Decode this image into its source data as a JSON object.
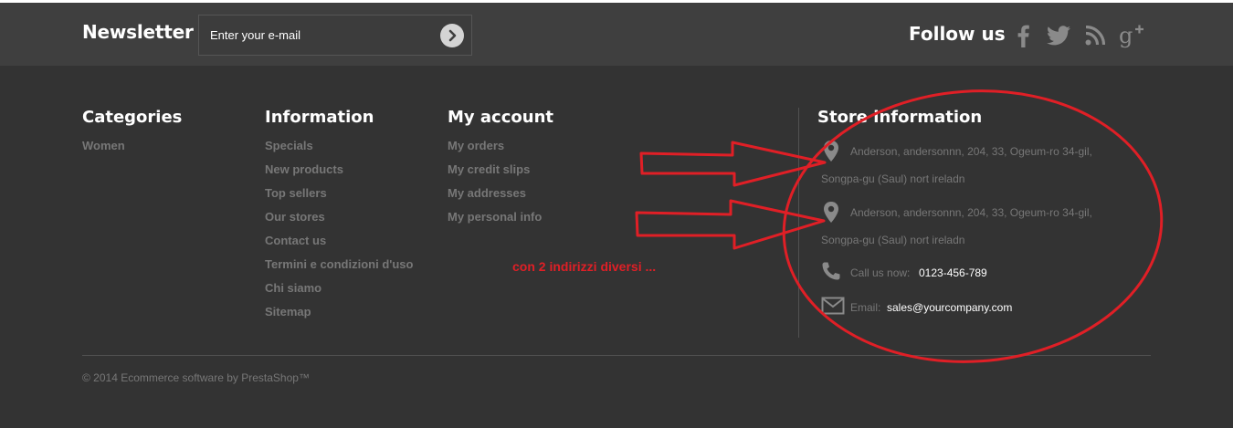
{
  "newsletter": {
    "title": "Newsletter",
    "placeholder": "Enter your e-mail",
    "submit_icon": "chevron-right-circle-icon"
  },
  "social": {
    "title": "Follow us",
    "icons": [
      "facebook-icon",
      "twitter-icon",
      "rss-icon",
      "google-plus-icon"
    ]
  },
  "columns": {
    "categories": {
      "title": "Categories",
      "items": [
        "Women"
      ]
    },
    "information": {
      "title": "Information",
      "items": [
        "Specials",
        "New products",
        "Top sellers",
        "Our stores",
        "Contact us",
        "Termini e condizioni d'uso",
        "Chi siamo",
        "Sitemap"
      ]
    },
    "account": {
      "title": "My account",
      "items": [
        "My orders",
        "My credit slips",
        "My addresses",
        "My personal info"
      ]
    }
  },
  "store": {
    "title": "Store information",
    "addresses": [
      {
        "line1": "Anderson, andersonnn, 204, 33, Ogeum-ro 34-gil,",
        "line2": "Songpa-gu (Saul) nort ireladn"
      },
      {
        "line1": "Anderson, andersonnn, 204, 33, Ogeum-ro 34-gil,",
        "line2": "Songpa-gu (Saul) nort ireladn"
      }
    ],
    "phone_label": "Call us now:",
    "phone": "0123-456-789",
    "email_label": "Email:",
    "email": "sales@yourcompany.com"
  },
  "copyright": "© 2014 Ecommerce software by PrestaShop™",
  "annotation": {
    "text": "con 2 indirizzi diversi ..."
  },
  "colors": {
    "topbar_bg": "#3f3f3f",
    "footer_bg": "#333333",
    "muted_text": "#777777",
    "annotation_red": "#e01f26"
  }
}
